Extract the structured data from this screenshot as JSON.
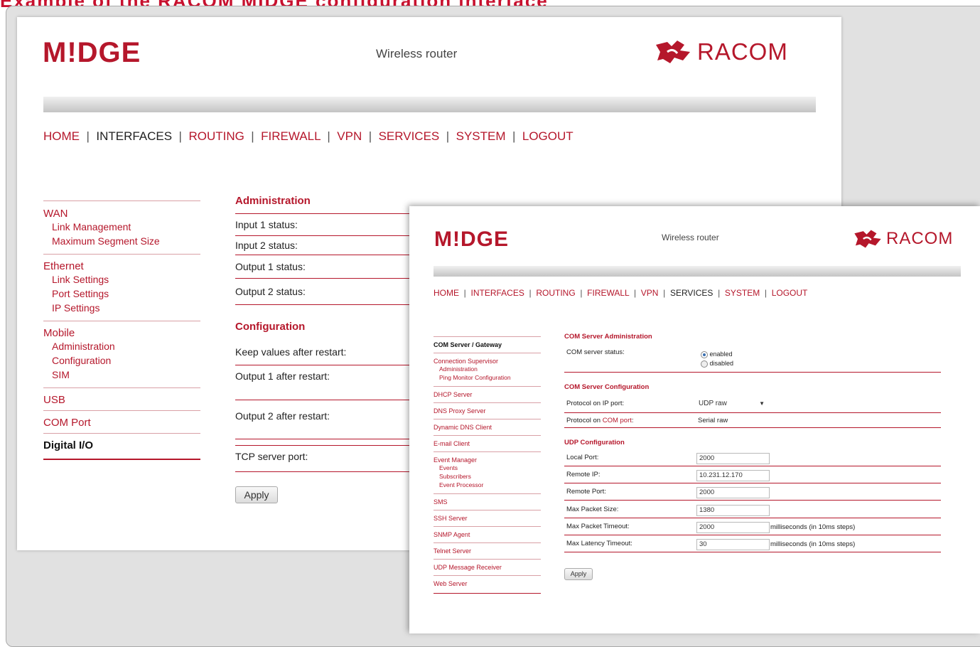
{
  "top_caption": "Example of the RACOM MIDGE configuration interface",
  "window1": {
    "brand": "M!DGE",
    "subtitle": "Wireless router",
    "racom": "RACOM",
    "menu": [
      "HOME",
      "INTERFACES",
      "ROUTING",
      "FIREWALL",
      "VPN",
      "SERVICES",
      "SYSTEM",
      "LOGOUT"
    ],
    "active_menu": "INTERFACES",
    "sidebar": {
      "wan": "WAN",
      "wan_items": [
        "Link Management",
        "Maximum Segment Size"
      ],
      "ethernet": "Ethernet",
      "ethernet_items": [
        "Link Settings",
        "Port Settings",
        "IP Settings"
      ],
      "mobile": "Mobile",
      "mobile_items": [
        "Administration",
        "Configuration",
        "SIM"
      ],
      "usb": "USB",
      "com": "COM Port",
      "dio": "Digital I/O"
    },
    "admin_title": "Administration",
    "admin_rows": [
      "Input 1 status:",
      "Input 2 status:",
      "Output 1 status:",
      "Output 2 status:"
    ],
    "config_title": "Configuration",
    "config_rows": [
      "Keep values after restart:",
      "Output 1 after restart:",
      "Output 2 after restart:",
      "TCP server port:"
    ],
    "apply": "Apply"
  },
  "window2": {
    "brand": "M!DGE",
    "subtitle": "Wireless router",
    "racom": "RACOM",
    "menu": [
      "HOME",
      "INTERFACES",
      "ROUTING",
      "FIREWALL",
      "VPN",
      "SERVICES",
      "SYSTEM",
      "LOGOUT"
    ],
    "active_menu": "SERVICES",
    "sidebar": {
      "com_gateway": "COM Server / Gateway",
      "conn_sup": "Connection Supervisor",
      "conn_items": [
        "Administration",
        "Ping Monitor Configuration"
      ],
      "dhcp": "DHCP Server",
      "dns": "DNS Proxy Server",
      "ddns": "Dynamic DNS Client",
      "email": "E-mail Client",
      "event": "Event Manager",
      "event_items": [
        "Events",
        "Subscribers",
        "Event Processor"
      ],
      "sms": "SMS",
      "ssh": "SSH Server",
      "snmp": "SNMP Agent",
      "telnet": "Telnet Server",
      "udp_msg": "UDP Message Receiver",
      "web": "Web Server"
    },
    "admin_title": "COM Server Administration",
    "status_label": "COM server status:",
    "enabled": "enabled",
    "disabled": "disabled",
    "enabled_checked": true,
    "config_title": "COM Server Configuration",
    "proto_ip_label": "Protocol on IP port:",
    "proto_ip_value": "UDP raw",
    "proto_com_label_a": "Protocol on",
    "proto_com_label_b": "COM port",
    "proto_com_label_c": ":",
    "proto_com_value": "Serial raw",
    "udp_title": "UDP Configuration",
    "fields": [
      {
        "label": "Local Port:",
        "value": "2000",
        "unit": ""
      },
      {
        "label": "Remote IP:",
        "value": "10.231.12.170",
        "unit": ""
      },
      {
        "label": "Remote Port:",
        "value": "2000",
        "unit": ""
      },
      {
        "label": "Max Packet Size:",
        "value": "1380",
        "unit": ""
      },
      {
        "label": "Max Packet Timeout:",
        "value": "2000",
        "unit": "milliseconds (in 10ms steps)"
      },
      {
        "label": "Max Latency Timeout:",
        "value": "30",
        "unit": "milliseconds (in 10ms steps)"
      }
    ],
    "apply": "Apply"
  },
  "colors": {
    "accent": "#b5172b",
    "background": "#e1e1e1"
  }
}
